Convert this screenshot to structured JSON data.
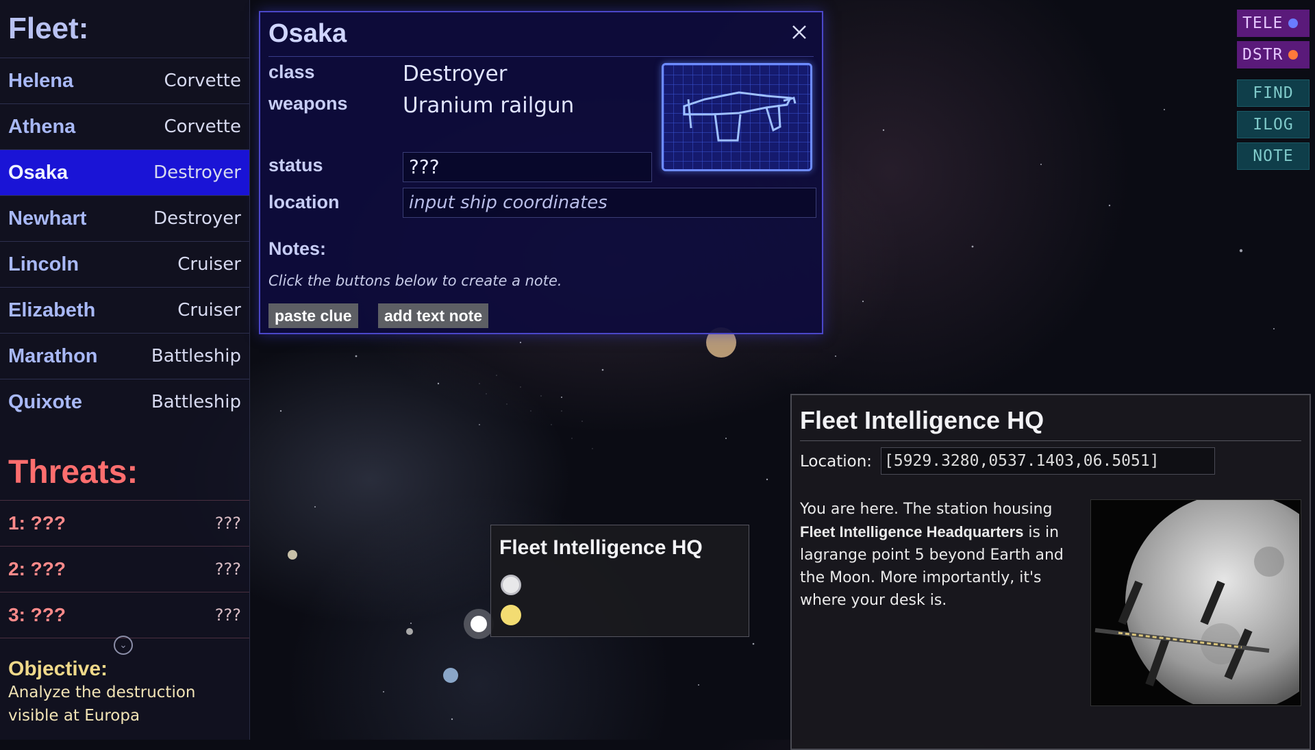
{
  "fleet": {
    "title": "Fleet:",
    "ships": [
      {
        "name": "Helena",
        "class": "Corvette"
      },
      {
        "name": "Athena",
        "class": "Corvette"
      },
      {
        "name": "Osaka",
        "class": "Destroyer"
      },
      {
        "name": "Newhart",
        "class": "Destroyer"
      },
      {
        "name": "Lincoln",
        "class": "Cruiser"
      },
      {
        "name": "Elizabeth",
        "class": "Cruiser"
      },
      {
        "name": "Marathon",
        "class": "Battleship"
      },
      {
        "name": "Quixote",
        "class": "Battleship"
      }
    ],
    "selected_index": 2
  },
  "threats": {
    "title": "Threats:",
    "items": [
      {
        "name": "1: ???",
        "value": "???"
      },
      {
        "name": "2: ???",
        "value": "???"
      },
      {
        "name": "3: ???",
        "value": "???"
      }
    ]
  },
  "objective": {
    "title": "Objective:",
    "text": "Analyze the destruction visible at Europa"
  },
  "ship_dialog": {
    "name": "Osaka",
    "class_label": "class",
    "class_value": "Destroyer",
    "weapons_label": "weapons",
    "weapons_value": "Uranium railgun",
    "status_label": "status",
    "status_value": "???",
    "location_label": "location",
    "location_placeholder": "input ship coordinates",
    "notes_label": "Notes:",
    "notes_hint": "Click the buttons below to create a note.",
    "paste_clue_label": "paste clue",
    "add_text_note_label": "add text note"
  },
  "side_buttons": {
    "tele": "TELE",
    "dstr": "DSTR",
    "find": "FIND",
    "ilog": "ILOG",
    "note": "NOTE"
  },
  "hq_panel": {
    "title": "Fleet Intelligence HQ",
    "location_label": "Location:",
    "location_value": "[5929.3280,0537.1403,06.5051]",
    "desc_1": "You are here. The station housing ",
    "desc_bold": "Fleet Intelligence Headquarters",
    "desc_2": " is in lagrange point 5 beyond Earth and the Moon. More importantly, it's where your desk is."
  },
  "map_tooltip": {
    "title": "Fleet Intelligence HQ"
  },
  "colors": {
    "selected_row": "#1a14d6",
    "threat_text": "#ff6e6e",
    "objective_text": "#f0d98a",
    "tele_dot": "#6a7cff",
    "dstr_dot": "#ff7a3a",
    "marker_white": "#e8e8ea",
    "marker_yellow": "#f3dc72"
  }
}
